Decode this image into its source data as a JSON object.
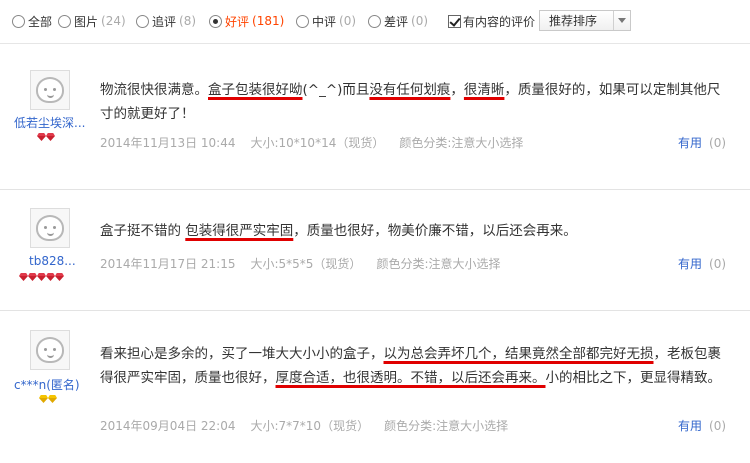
{
  "filters": [
    {
      "label": "全部",
      "count": "",
      "checked": false
    },
    {
      "label": "图片",
      "count": "(24)",
      "checked": false
    },
    {
      "label": "追评",
      "count": "(8)",
      "checked": false
    },
    {
      "label": "好评",
      "count": "(181)",
      "checked": true
    },
    {
      "label": "中评",
      "count": "(0)",
      "checked": false
    },
    {
      "label": "差评",
      "count": "(0)",
      "checked": false
    }
  ],
  "content_filter": {
    "label": "有内容的评价",
    "checked": true
  },
  "sort": {
    "selected": "推荐排序"
  },
  "reviews": [
    {
      "username": "低若尘埃深...",
      "gems": {
        "color": "#c8202f",
        "count": 2
      },
      "content": [
        {
          "t": "物流很快很满意。",
          "u": false
        },
        {
          "t": "盒子包装很好呦",
          "u": true
        },
        {
          "t": "(^_^)而且",
          "u": false
        },
        {
          "t": "没有任何划痕",
          "u": true
        },
        {
          "t": "，",
          "u": false
        },
        {
          "t": "很清晰",
          "u": true
        },
        {
          "t": "，质量很好的，如果可以定制其他尺寸的就更好了！",
          "u": false
        }
      ],
      "date": "2014年11月13日 10:44",
      "size": "大小:10*10*14（现货）",
      "color": "颜色分类:注意大小选择",
      "useful_label": "有用",
      "useful_count": "(0)"
    },
    {
      "username": "tb828...",
      "gems": {
        "color": "#c8202f",
        "count": 5
      },
      "content": [
        {
          "t": "盒子挺不错的 ",
          "u": false
        },
        {
          "t": "包装得很严实牢固",
          "u": true
        },
        {
          "t": "，质量也很好，物美价廉不错，以后还会再来。",
          "u": false
        }
      ],
      "date": "2014年11月17日 21:15",
      "size": "大小:5*5*5（现货）",
      "color": "颜色分类:注意大小选择",
      "useful_label": "有用",
      "useful_count": "(0)"
    },
    {
      "username": "c***n(匿名)",
      "gems": {
        "color": "#f5c400",
        "count": 2
      },
      "content": [
        {
          "t": "看来担心是多余的，买了一堆大大小小的盒子，",
          "u": false
        },
        {
          "t": "以为总会弄坏几个，结果竟然全部都完好无损",
          "u": true
        },
        {
          "t": "，老板包裹得很严实牢固，质量也很好，",
          "u": false
        },
        {
          "t": "厚度合适，也很透明。不错，以后还会再来。",
          "u": true
        },
        {
          "t": "小的相比之下，更显得精致。",
          "u": false
        }
      ],
      "date": "2014年09月04日 22:04",
      "size": "大小:7*7*10（现货）",
      "color": "颜色分类:注意大小选择",
      "useful_label": "有用",
      "useful_count": "(0)"
    }
  ]
}
